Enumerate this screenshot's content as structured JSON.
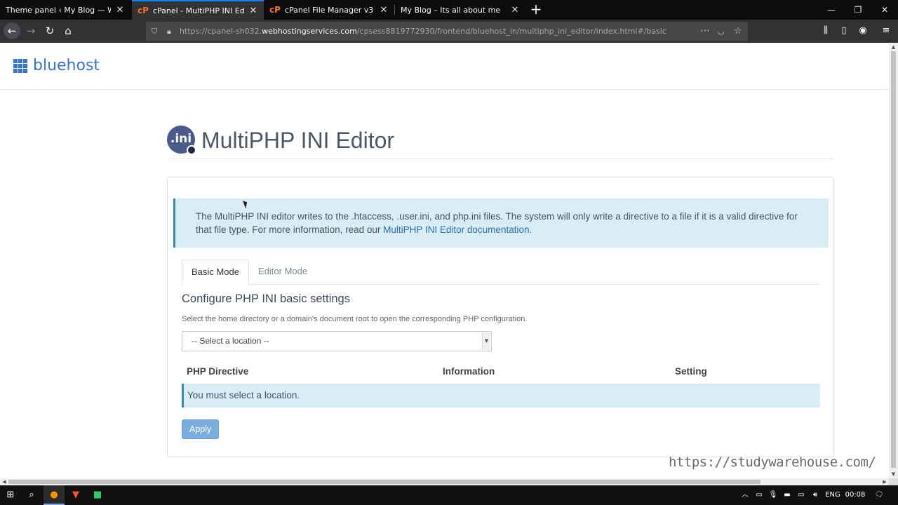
{
  "browser": {
    "tabs": [
      {
        "title": "Theme panel ‹ My Blog — WordPre",
        "active": false
      },
      {
        "title": "cPanel - MultiPHP INI Editor",
        "active": true
      },
      {
        "title": "cPanel File Manager v3",
        "active": false
      },
      {
        "title": "My Blog – Its all about me",
        "active": false
      }
    ],
    "new_tab": "+",
    "url": {
      "prefix": "https://cpanel-sh032.",
      "host": "webhostingservices.com",
      "path": "/cpsess8819772930/frontend/bluehost_in/multiphp_ini_editor/index.html#/basic"
    },
    "icons": {
      "back": "back-arrow-icon",
      "forward": "forward-arrow-icon",
      "reload": "reload-icon",
      "home": "home-icon",
      "shield": "tracking-shield-icon",
      "lock": "lock-icon",
      "more": "more-dots-icon",
      "pocket": "pocket-icon",
      "bookmark": "star-icon",
      "library": "library-icon",
      "sidebar": "sidebar-icon",
      "account": "account-icon",
      "menu": "hamburger-menu-icon"
    }
  },
  "page": {
    "brand": "bluehost",
    "ini_badge": ".ini",
    "title": "MultiPHP INI Editor",
    "info": {
      "text": "The MultiPHP INI editor writes to the .htaccess, .user.ini, and php.ini files. The system will only write a directive to a file if it is a valid directive for that file type. For more information, read our ",
      "link": "MultiPHP INI Editor documentation",
      "suffix": "."
    },
    "tabs": [
      {
        "label": "Basic Mode",
        "active": true
      },
      {
        "label": "Editor Mode",
        "active": false
      }
    ],
    "section_title": "Configure PHP INI basic settings",
    "help": "Select the home directory or a domain’s document root to open the corresponding PHP configuration.",
    "select": {
      "value": "-- Select a location --"
    },
    "table": {
      "headers": [
        "PHP Directive",
        "Information",
        "Setting"
      ],
      "empty_message": "You must select a location."
    },
    "apply_label": "Apply",
    "watermark": "https://studywarehouse.com/"
  },
  "taskbar": {
    "lang": "ENG",
    "clock": "00:08"
  },
  "colors": {
    "brand_blue": "#3575d3",
    "info_bg": "#d9edf7",
    "apply_btn": "#7aaee0",
    "tab_accent": "#0a84ff"
  }
}
